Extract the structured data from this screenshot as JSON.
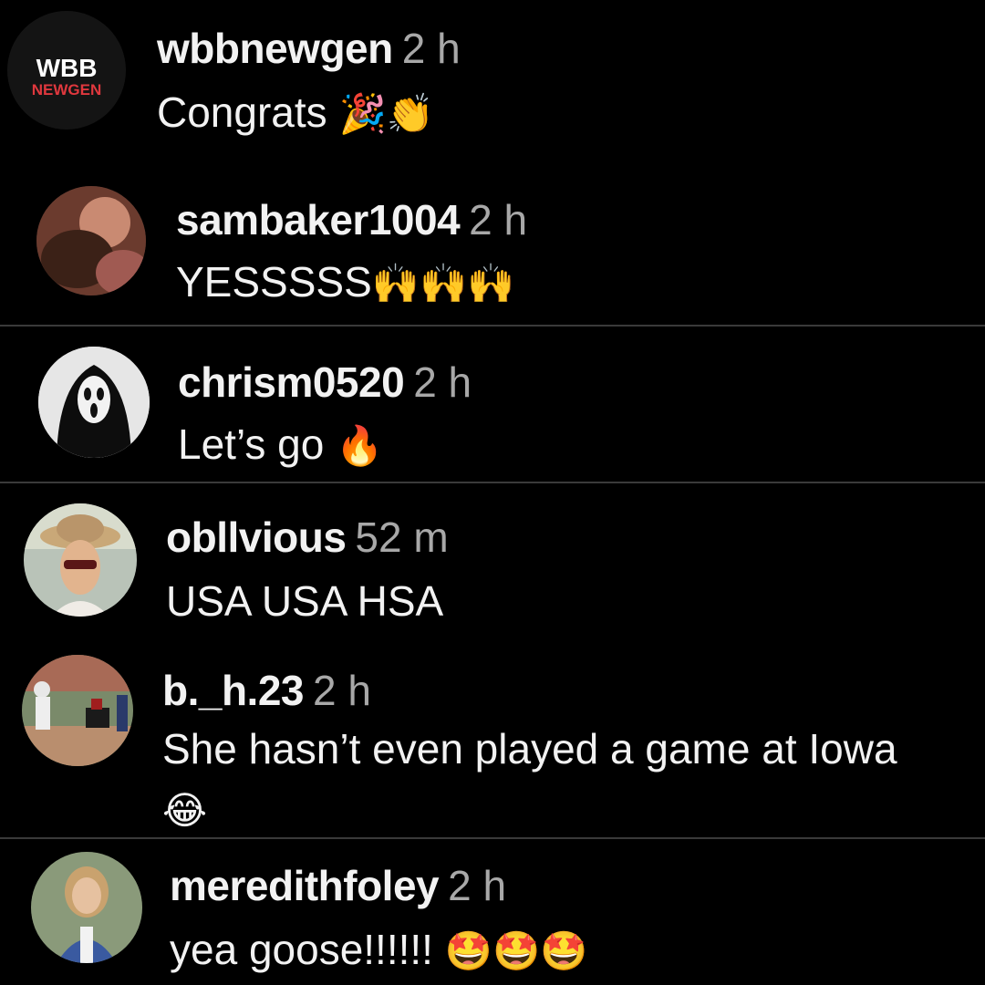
{
  "comments": [
    {
      "username": "wbbnewgen",
      "time": "2 h",
      "text": "Congrats",
      "emoji": "🎉👏",
      "logo_top": "WBB",
      "logo_bottom": "NEWGEN"
    },
    {
      "username": "sambaker1004",
      "time": "2 h",
      "text": "YESSSSS",
      "emoji": "🙌🙌🙌"
    },
    {
      "username": "chrism0520",
      "time": "2 h",
      "text": "Let’s go ",
      "emoji": "🔥"
    },
    {
      "username": "obllvious",
      "time": "52 m",
      "text": "USA USA HSA",
      "emoji": ""
    },
    {
      "username": "b._h.23",
      "time": "2 h",
      "text": "She hasn’t even played a game at Iowa ",
      "emoji": "😂"
    },
    {
      "username": "meredithfoley",
      "time": "2 h",
      "text": "yea goose!!!!!! ",
      "emoji": "🤩🤩🤩"
    }
  ],
  "colors": {
    "background": "#000000",
    "username": "#f2f2f2",
    "time": "#a8a8a8",
    "divider": "#3a3a3a",
    "logo_red": "#e0383e"
  }
}
